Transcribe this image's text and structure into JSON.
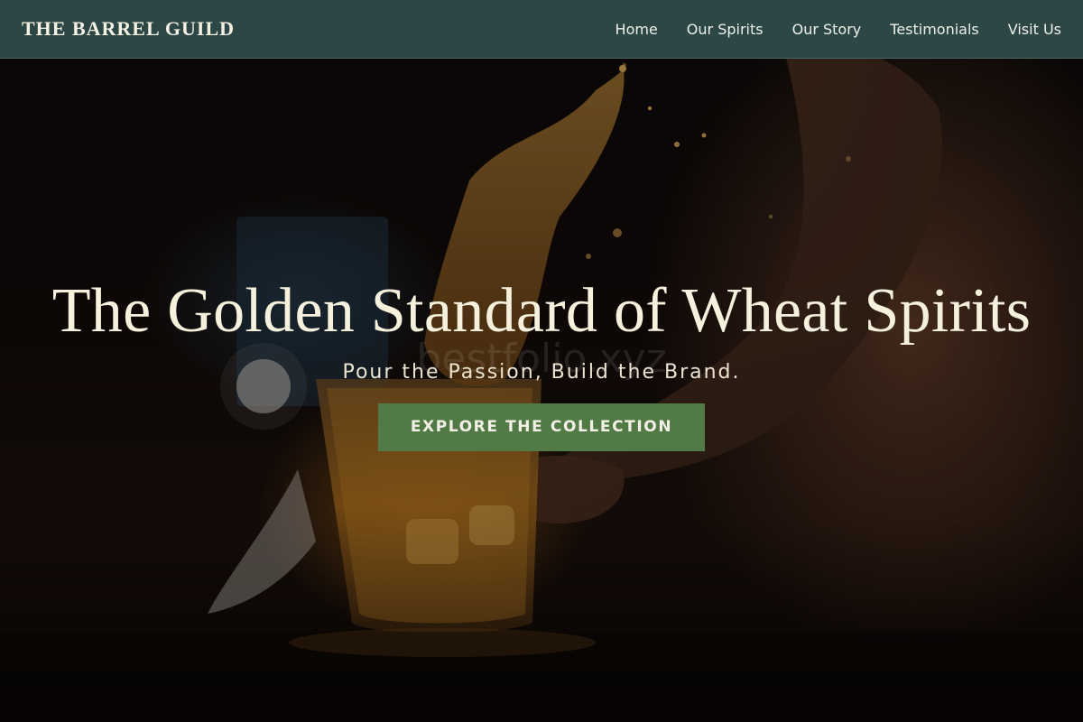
{
  "header": {
    "logo": "THE BARREL GUILD",
    "nav": [
      {
        "label": "Home"
      },
      {
        "label": "Our Spirits"
      },
      {
        "label": "Our Story"
      },
      {
        "label": "Testimonials"
      },
      {
        "label": "Visit Us"
      }
    ]
  },
  "hero": {
    "title": "The Golden Standard of Wheat Spirits",
    "subtitle": "Pour the Passion, Build the Brand.",
    "cta_label": "EXPLORE THE COLLECTION",
    "watermark": "bestfolio.xyz"
  },
  "colors": {
    "header_bg": "#2d4746",
    "cta_bg": "#527a47",
    "title_text": "#f6f1dd"
  }
}
